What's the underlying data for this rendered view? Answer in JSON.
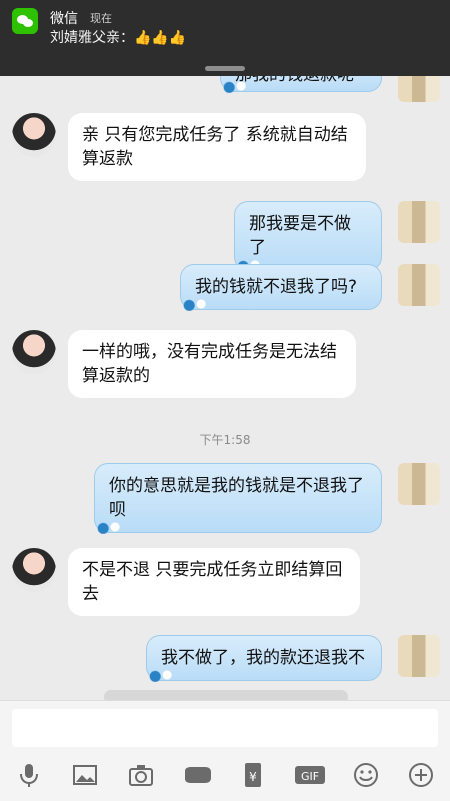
{
  "notification": {
    "app": "微信",
    "when": "现在",
    "message": "刘婧雅父亲：👍👍👍"
  },
  "chat": {
    "partial_top_text": "那我的钱退款呢",
    "messages": [
      {
        "side": "left",
        "text": "亲 只有您完成任务了 系统就自动结算返款"
      },
      {
        "side": "right",
        "text": "那我要是不做了"
      },
      {
        "side": "right",
        "text": "我的钱就不退我了吗?"
      },
      {
        "side": "left",
        "text": "一样的哦，没有完成任务是无法结算返款的"
      },
      {
        "side": "right",
        "text": "你的意思就是我的钱就是不退我了呗"
      },
      {
        "side": "left",
        "text": "不是不退 只要完成任务立即结算回去"
      },
      {
        "side": "right",
        "text": "我不做了，我的款还退我不"
      }
    ],
    "timestamp": "下午1:58"
  },
  "input": {
    "placeholder": ""
  },
  "toolbar": {
    "icons": [
      "mic-icon",
      "image-icon",
      "camera-icon",
      "voice-call-icon",
      "red-packet-icon",
      "gif-icon",
      "emoji-icon",
      "plus-icon"
    ],
    "gif_label": "GIF",
    "yen_label": "¥"
  }
}
